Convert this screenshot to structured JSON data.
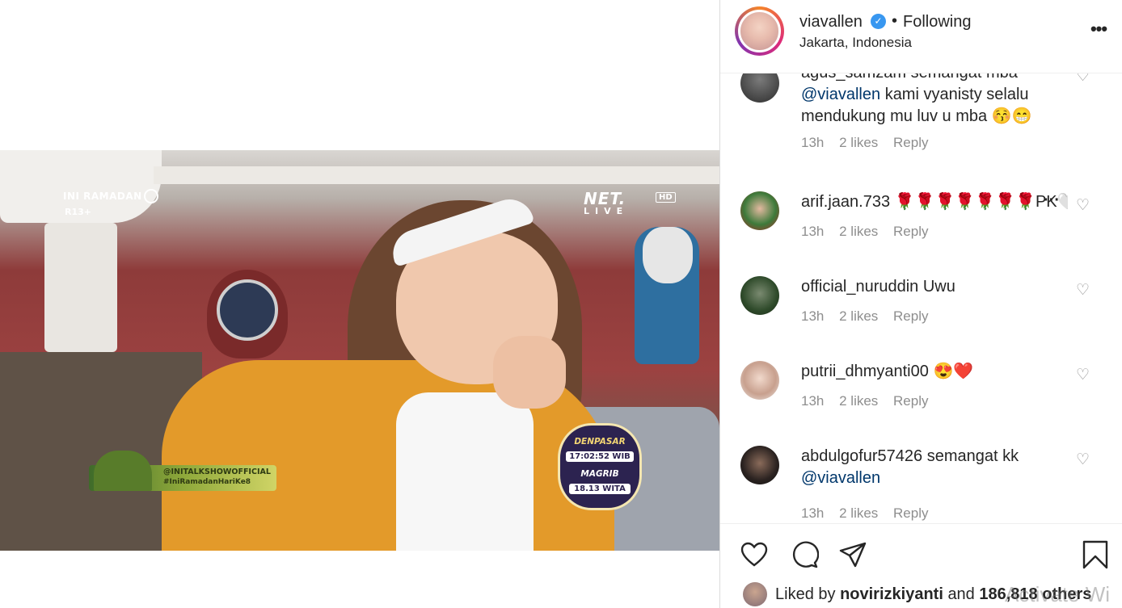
{
  "video": {
    "show_tag": "INI RAMADAN",
    "rating": "R13+",
    "network": "NET.",
    "network_hd": "HD",
    "network_live": "LIVE",
    "hashtag_handle": "@INITALKSHOWOFFICIAL",
    "hashtag": "#IniRamadanHariKe8",
    "badge": {
      "city": "DENPASAR",
      "time": "17:02:52 WIB",
      "label": "MAGRIB",
      "magrib_time": "18.13 WITA"
    }
  },
  "header": {
    "username": "viavallen",
    "verified_icon": "verified-badge-icon",
    "separator": "•",
    "follow_status": "Following",
    "location": "Jakarta, Indonesia",
    "more_icon": "more-options-icon"
  },
  "comments": [
    {
      "username": "agus_samzam",
      "text": "semangat mba",
      "mention": "@viavallen",
      "text_after": "kami vyanisty selalu mendukung mu luv u mba 😚😁",
      "time": "13h",
      "likes": "2 likes",
      "reply": "Reply"
    },
    {
      "username": "arif.jaan.733",
      "text": "🌹🌹🌹🌹🌹🌹🌹PK🤍",
      "mention": "",
      "text_after": "",
      "time": "13h",
      "likes": "2 likes",
      "reply": "Reply"
    },
    {
      "username": "official_nuruddin",
      "text": "Uwu",
      "mention": "",
      "text_after": "",
      "time": "13h",
      "likes": "2 likes",
      "reply": "Reply"
    },
    {
      "username": "putrii_dhmyanti00",
      "text": "😍❤️",
      "mention": "",
      "text_after": "",
      "time": "13h",
      "likes": "2 likes",
      "reply": "Reply"
    },
    {
      "username": "abdulgofur57426",
      "text": "semangat kk",
      "mention": "@viavallen",
      "text_after": "",
      "time": "13h",
      "likes": "2 likes",
      "reply": "Reply"
    }
  ],
  "actions": {
    "like_icon": "heart-icon",
    "comment_icon": "comment-icon",
    "share_icon": "paper-plane-icon",
    "save_icon": "bookmark-icon"
  },
  "liked_by": {
    "prefix": "Liked by",
    "user": "novirizkiyanti",
    "conjunction": "and",
    "count": "186,818 others"
  },
  "watermark": "Activate Wi",
  "colors": {
    "verified": "#3897f0",
    "mention": "#00376b",
    "muted": "#8e8e8e",
    "text": "#262626"
  }
}
